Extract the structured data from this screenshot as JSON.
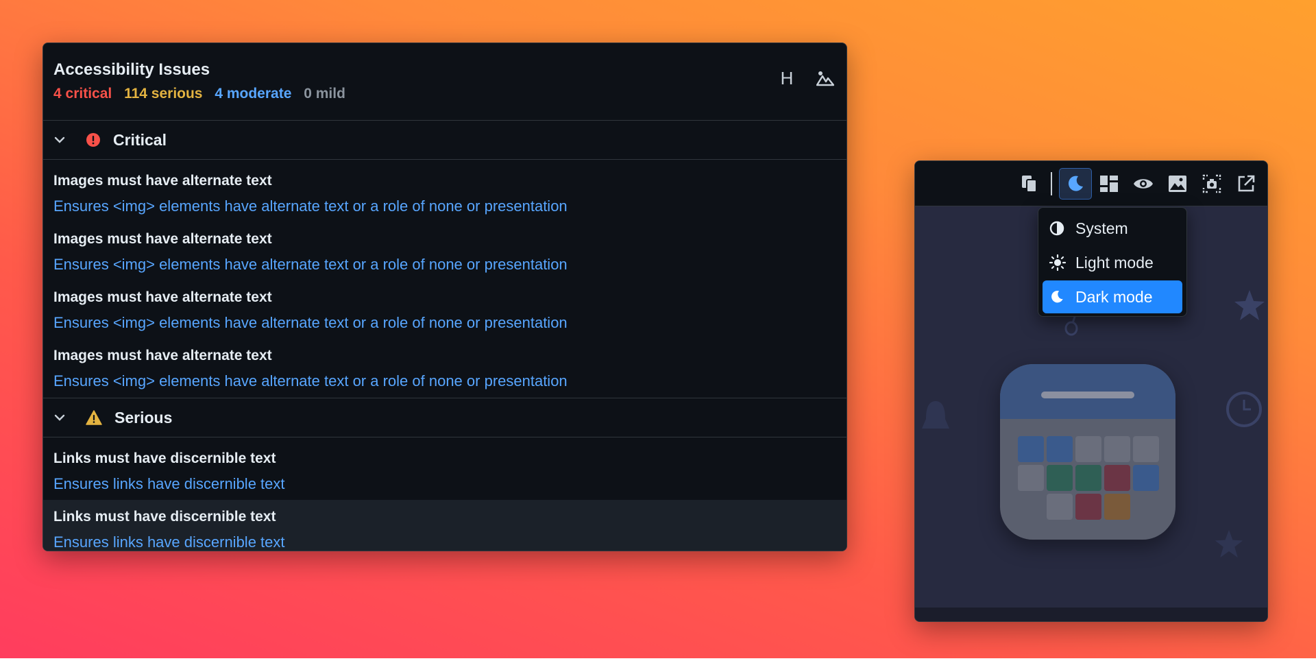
{
  "issues_panel": {
    "title": "Accessibility Issues",
    "counts": {
      "critical": "4 critical",
      "serious": "114 serious",
      "moderate": "4 moderate",
      "mild": "0 mild"
    },
    "actions": [
      {
        "name": "heading-toggle",
        "label": "H"
      },
      {
        "name": "image-toggle",
        "icon": "image-mountain-icon"
      }
    ],
    "sections": [
      {
        "label": "Critical",
        "icon": "critical-exclamation-icon",
        "color": "#f85149",
        "items": [
          {
            "title": "Images must have alternate text",
            "description": "Ensures <img> elements have alternate text or a role of none or presentation"
          },
          {
            "title": "Images must have alternate text",
            "description": "Ensures <img> elements have alternate text or a role of none or presentation"
          },
          {
            "title": "Images must have alternate text",
            "description": "Ensures <img> elements have alternate text or a role of none or presentation"
          },
          {
            "title": "Images must have alternate text",
            "description": "Ensures <img> elements have alternate text or a role of none or presentation"
          }
        ]
      },
      {
        "label": "Serious",
        "icon": "warning-triangle-icon",
        "color": "#e3b341",
        "items": [
          {
            "title": "Links must have discernible text",
            "description": "Ensures links have discernible text"
          },
          {
            "title": "Links must have discernible text",
            "description": "Ensures links have discernible text"
          }
        ]
      }
    ]
  },
  "preview": {
    "toolbar": [
      {
        "name": "copy-icon"
      },
      {
        "name": "moon-icon",
        "active": true
      },
      {
        "name": "layout-icon"
      },
      {
        "name": "eye-icon"
      },
      {
        "name": "image-icon"
      },
      {
        "name": "screenshot-icon"
      },
      {
        "name": "open-external-icon"
      }
    ],
    "theme_menu": [
      {
        "label": "System",
        "icon": "half-circle-icon",
        "selected": false
      },
      {
        "label": "Light mode",
        "icon": "sun-icon",
        "selected": false
      },
      {
        "label": "Dark mode",
        "icon": "moon-icon",
        "selected": true
      }
    ]
  },
  "colors": {
    "critical": "#f85149",
    "serious": "#e3b341",
    "moderate": "#58a6ff",
    "mild": "#8b949e",
    "accent": "#2188ff"
  }
}
